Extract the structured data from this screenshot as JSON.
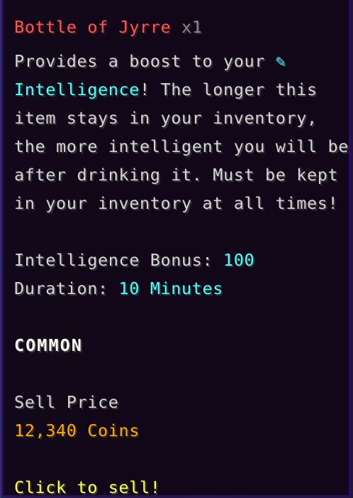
{
  "item": {
    "name": "Bottle of Jyrre",
    "count": "x1",
    "description_lines": [
      "Provides a boost to your ",
      "! The longer this",
      "item stays in your inventory,",
      "the more intelligent you will be",
      "after drinking it. Must be kept",
      "in your inventory at all times!"
    ],
    "stat_icon": "✎",
    "stat_name": "Intelligence",
    "stats": [
      {
        "label": "Intelligence Bonus: ",
        "value": "100"
      },
      {
        "label": "Duration: ",
        "value": "10 Minutes"
      }
    ],
    "rarity": "COMMON",
    "sell_label": "Sell Price",
    "sell_value": "12,340 Coins",
    "action": "Click to sell!"
  },
  "colors": {
    "name": "#ff5555",
    "count": "#8a8a8a",
    "text": "#d6d6d6",
    "stat": "#55ffff",
    "price": "#ffaa00",
    "action": "#ffff55",
    "rarity": "#ffffff",
    "border": "#2a0f5e"
  }
}
